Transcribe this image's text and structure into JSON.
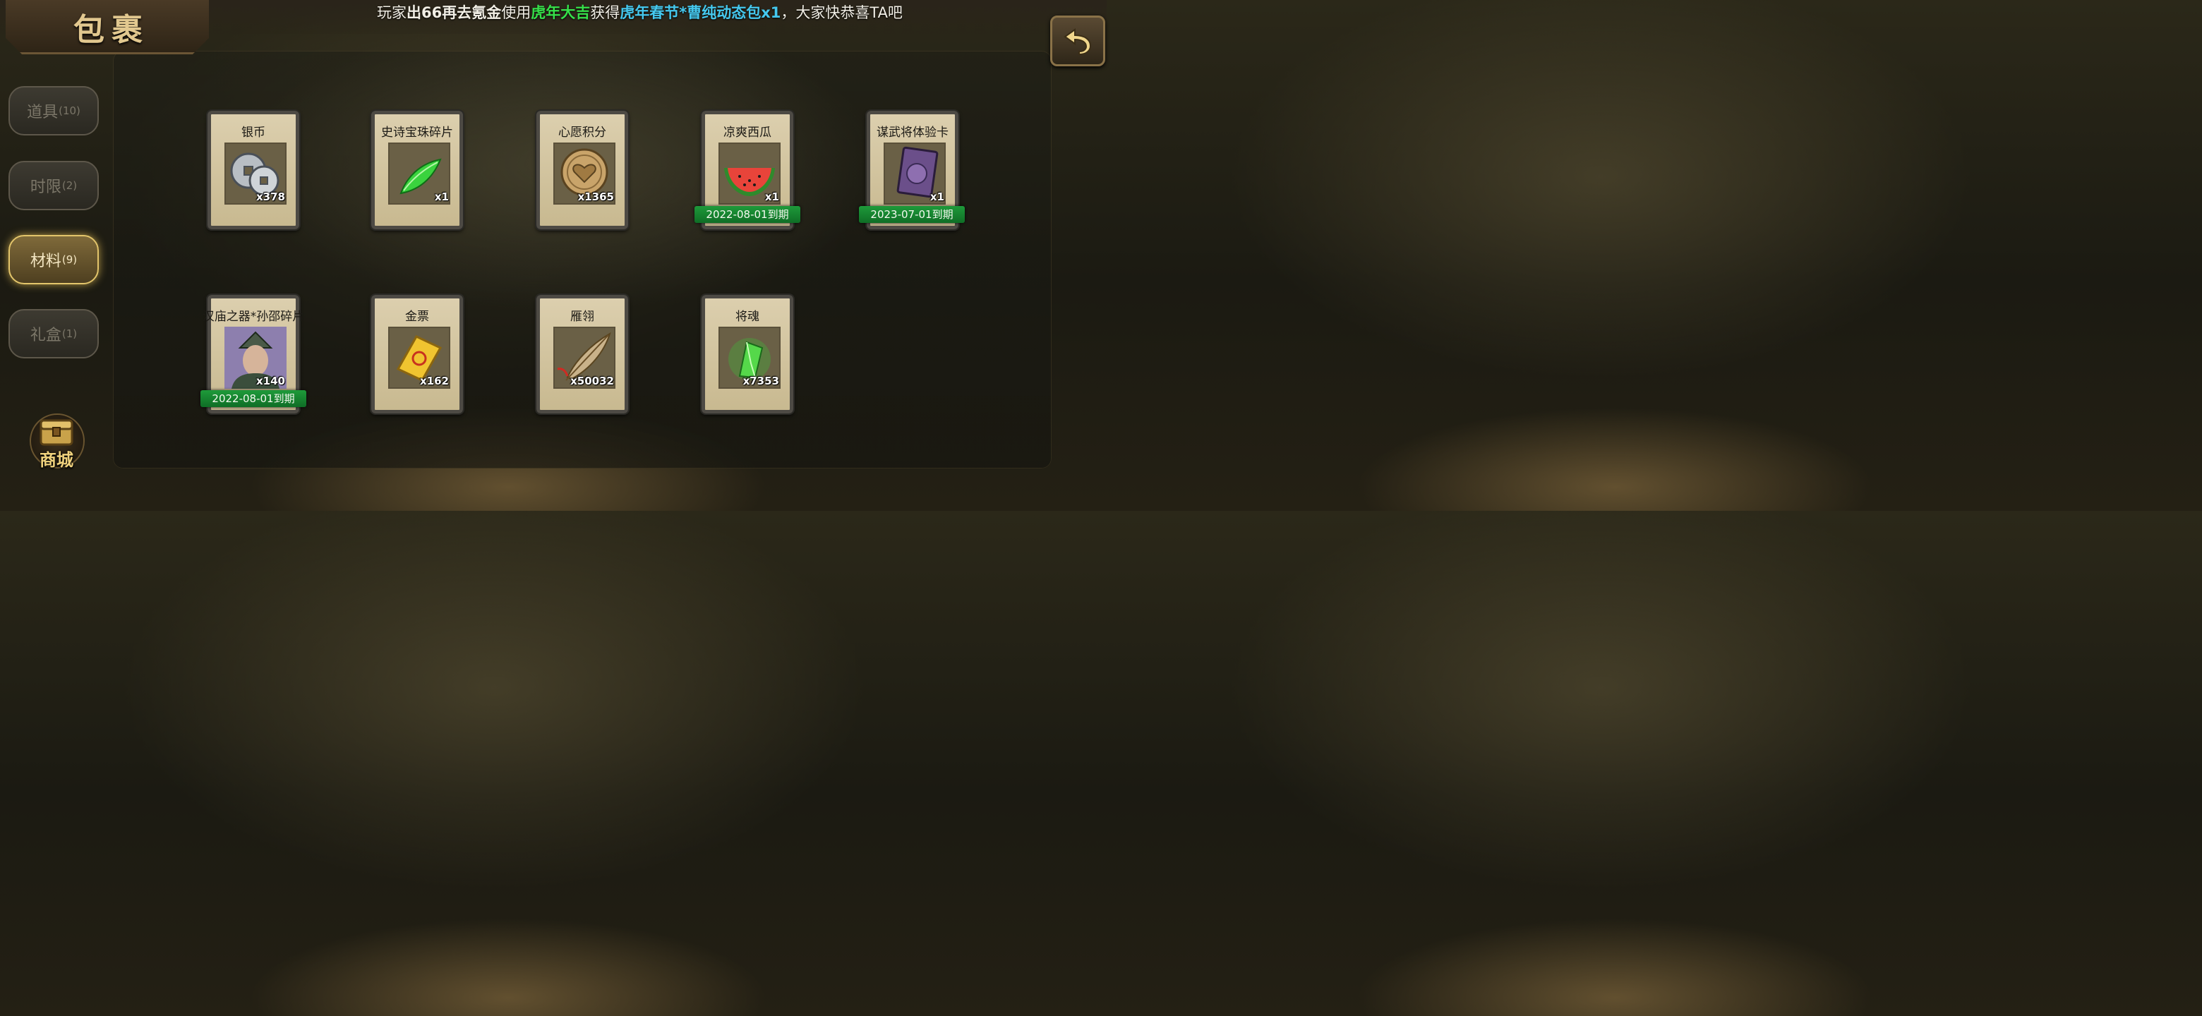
{
  "title": "包裹",
  "broadcast": {
    "prefix": "玩家",
    "player": "出66再去氪金",
    "used_text": "使用",
    "used_item": "虎年大吉",
    "got_text": "获得",
    "reward": "虎年春节*曹纯动态包x1",
    "suffix": "，大家快恭喜TA吧"
  },
  "tabs": [
    {
      "label": "道具",
      "count": "(10)",
      "active": false
    },
    {
      "label": "时限",
      "count": "(2)",
      "active": false
    },
    {
      "label": "材料",
      "count": "(9)",
      "active": true
    },
    {
      "label": "礼盒",
      "count": "(1)",
      "active": false
    }
  ],
  "shop": {
    "label": "商城"
  },
  "items": [
    {
      "name": "银币",
      "qty": "x378",
      "icon": "silver-coins-icon"
    },
    {
      "name": "史诗宝珠碎片",
      "qty": "x1",
      "icon": "green-gem-shard-icon"
    },
    {
      "name": "心愿积分",
      "qty": "x1365",
      "icon": "heart-coin-icon"
    },
    {
      "name": "凉爽西瓜",
      "qty": "x1",
      "icon": "watermelon-icon",
      "expiry": "2022-08-01到期"
    },
    {
      "name": "谋武将体验卡",
      "qty": "x1",
      "icon": "general-card-icon",
      "expiry": "2023-07-01到期"
    },
    {
      "name": "汉庙之器*孙邵碎片",
      "qty": "x140",
      "icon": "hero-portrait-icon",
      "expiry": "2022-08-01到期"
    },
    {
      "name": "金票",
      "qty": "x162",
      "icon": "gold-ticket-icon"
    },
    {
      "name": "雁翎",
      "qty": "x50032",
      "icon": "feather-icon"
    },
    {
      "name": "将魂",
      "qty": "x7353",
      "icon": "soul-crystal-icon"
    }
  ],
  "colors": {
    "accent_gold": "#e3c56b",
    "expiry_green": "#1e9a3a",
    "broadcast_green": "#36e04a",
    "broadcast_cyan": "#45c8ee"
  }
}
